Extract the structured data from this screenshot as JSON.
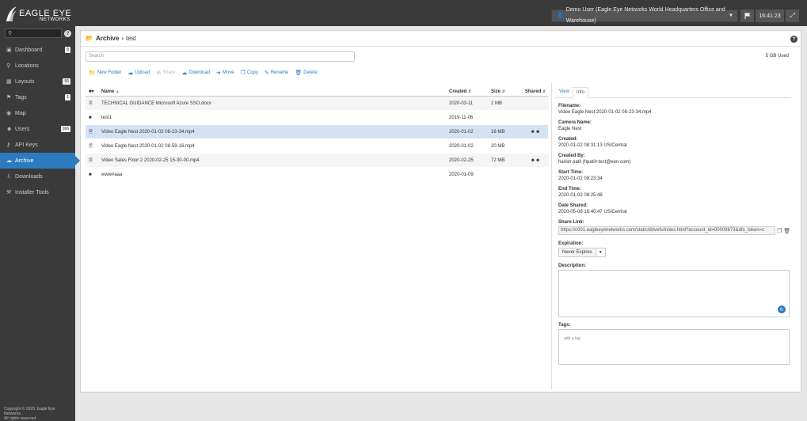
{
  "topbar": {
    "logo_line1": "EAGLE EYE",
    "logo_line2": "NETWORKS",
    "user_label": "Demo User (Eagle Eye Networks World Headquarters Office and Warehouse)",
    "clock": "16:41:23"
  },
  "sidebar": {
    "items": [
      {
        "label": "Dashboard",
        "icon": "dashboard-icon",
        "badge": "8"
      },
      {
        "label": "Locations",
        "icon": "location-pin-icon",
        "badge": ""
      },
      {
        "label": "Layouts",
        "icon": "grid-icon",
        "badge": "56"
      },
      {
        "label": "Tags",
        "icon": "tag-icon",
        "badge": "1"
      },
      {
        "label": "Map",
        "icon": "globe-icon",
        "badge": ""
      },
      {
        "label": "Users",
        "icon": "users-icon",
        "badge": "166"
      },
      {
        "label": "API Keys",
        "icon": "key-icon",
        "badge": ""
      },
      {
        "label": "Archive",
        "icon": "cloud-icon",
        "badge": ""
      },
      {
        "label": "Downloads",
        "icon": "download-icon",
        "badge": ""
      },
      {
        "label": "Installer Tools",
        "icon": "wrench-icon",
        "badge": ""
      }
    ],
    "active_index": 7,
    "copyright_line1": "Copyright © 2020, Eagle Eye Networks.",
    "copyright_line2": "All rights reserved."
  },
  "breadcrumb": {
    "root": "Archive",
    "current": "test"
  },
  "search": {
    "placeholder": "Search"
  },
  "storage_used": "5 GB Used",
  "toolbar": {
    "new_folder": "New Folder",
    "upload": "Upload",
    "share": "Share",
    "download": "Download",
    "move": "Move",
    "copy": "Copy",
    "rename": "Rename",
    "delete": "Delete"
  },
  "table": {
    "headers": {
      "name": "Name",
      "created": "Created",
      "size": "Size",
      "shared": "Shared"
    },
    "rows": [
      {
        "type": "file",
        "name": "TECHNICAL GUIDANCE Microsoft Azure SSO.docx",
        "created": "2020-03-11",
        "size": "2 MB",
        "shared": false
      },
      {
        "type": "folder",
        "name": "test1",
        "created": "2019-11-06",
        "size": "",
        "shared": false
      },
      {
        "type": "video",
        "name": "Video Eagle Nest 2020-01-02 08-23-34.mp4",
        "created": "2020-01-02",
        "size": "16 MB",
        "shared": true
      },
      {
        "type": "video",
        "name": "Video Eagle Nest 2020-01-02 08-59-16.mp4",
        "created": "2020-01-02",
        "size": "20 MB",
        "shared": false
      },
      {
        "type": "video",
        "name": "Video Sales Floor 2 2020-02-25 15-30-00.mp4",
        "created": "2020-02-25",
        "size": "72 MB",
        "shared": true
      },
      {
        "type": "folder",
        "name": "www#aaa",
        "created": "2020-01-09",
        "size": "",
        "shared": false
      }
    ],
    "selected_index": 2
  },
  "info": {
    "tab_view": "View",
    "tab_info": "Info",
    "filename_label": "Filename:",
    "filename": "Video Eagle Nest 2020-01-02 08-23-34.mp4",
    "camera_label": "Camera Name:",
    "camera": "Eagle Nest",
    "created_label": "Created:",
    "created": "2020-01-02 08:31:13 US/Central",
    "created_by_label": "Created By:",
    "created_by": "harish patil (hpatil+test@een.com)",
    "start_label": "Start Time:",
    "start": "2020-01-02 08:23:34",
    "end_label": "End Time:",
    "end": "2020-01-02 08:25:48",
    "date_shared_label": "Date Shared:",
    "date_shared": "2020-05-08 16:40:47 US/Central",
    "share_link_label": "Share Link:",
    "share_link": "https://c001.eagleeyenetworks.com/static/drivefs/index.html?account_id=00009673&dfs_token=c",
    "expiration_label": "Expiration:",
    "expiration": "Never Expires",
    "description_label": "Description:",
    "tags_label": "Tags:",
    "tags_placeholder": "add a tag"
  }
}
